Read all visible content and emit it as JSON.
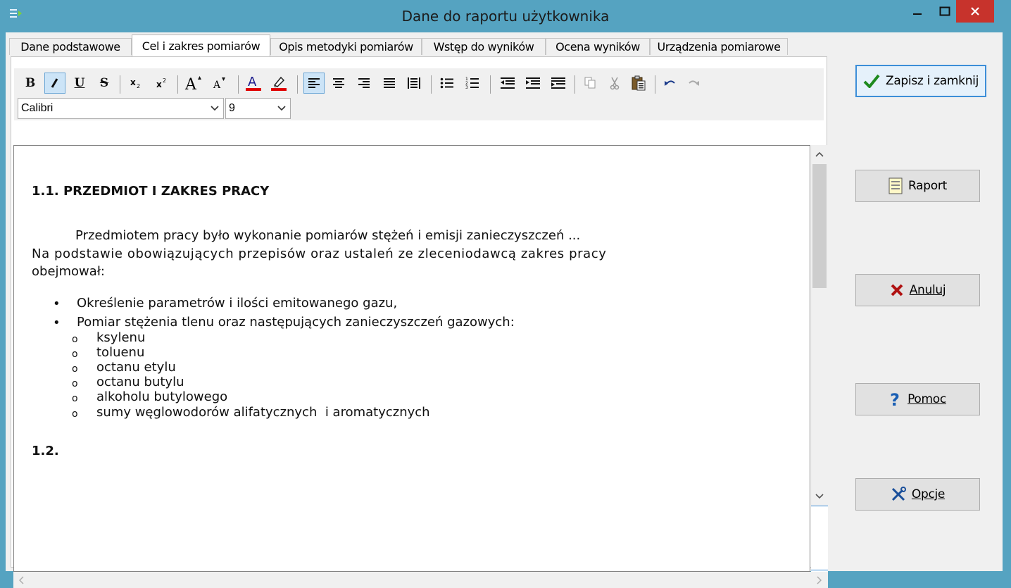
{
  "window": {
    "title": "Dane do raportu użytkownika"
  },
  "tabs": [
    {
      "label": "Dane podstawowe"
    },
    {
      "label": "Cel i zakres pomiarów",
      "active": true
    },
    {
      "label": "Opis metodyki pomiarów"
    },
    {
      "label": "Wstęp do wyników"
    },
    {
      "label": "Ocena wyników"
    },
    {
      "label": "Urządzenia pomiarowe"
    }
  ],
  "toolbar": {
    "bold": "B",
    "italic": "I",
    "underline": "U",
    "strike": "S",
    "font_name": "Calibri",
    "font_size": "9"
  },
  "document": {
    "heading1": "1.1. PRZEDMIOT I ZAKRES PRACY",
    "para1_line1": "Przedmiotem pracy było wykonanie pomiarów stężeń i emisji zanieczyszczeń ...",
    "para1_line2": "Na podstawie obowiązujących przepisów oraz ustaleń ze zleceniodawcą zakres pracy",
    "para1_line3": "obejmował:",
    "bullets": [
      "Określenie parametrów i ilości emitowanego gazu,",
      "Pomiar stężenia tlenu oraz następujących zanieczyszczeń gazowych:"
    ],
    "sub_bullets": [
      "ksylenu",
      "toluenu",
      "octanu etylu",
      "octanu butylu",
      "alkoholu butylowego",
      "sumy węglowodorów alifatycznych  i aromatycznych"
    ],
    "heading2": "1.2."
  },
  "side_buttons": {
    "save_close": "Zapisz i zamknij",
    "report": "Raport",
    "cancel": "Anuluj",
    "help": "Pomoc",
    "options": "Opcje"
  }
}
